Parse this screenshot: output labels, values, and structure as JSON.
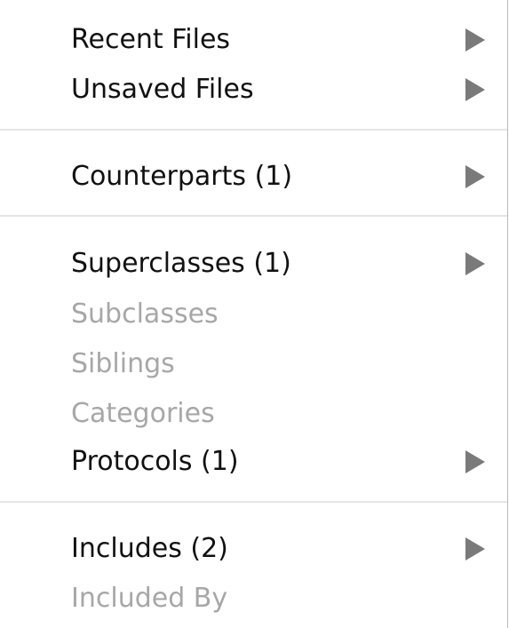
{
  "menu": {
    "recent_files": "Recent Files",
    "unsaved_files": "Unsaved Files",
    "counterparts": "Counterparts (1)",
    "superclasses": "Superclasses (1)",
    "subclasses": "Subclasses",
    "siblings": "Siblings",
    "categories": "Categories",
    "protocols": "Protocols (1)",
    "includes": "Includes (2)",
    "included_by": "Included By"
  },
  "icons": {
    "submenu": "submenu-triangle-icon"
  },
  "colors": {
    "enabled_text": "#111111",
    "disabled_text": "#a7a7a7",
    "separator": "#e5e5e5",
    "arrow": "#7a7a7a"
  }
}
